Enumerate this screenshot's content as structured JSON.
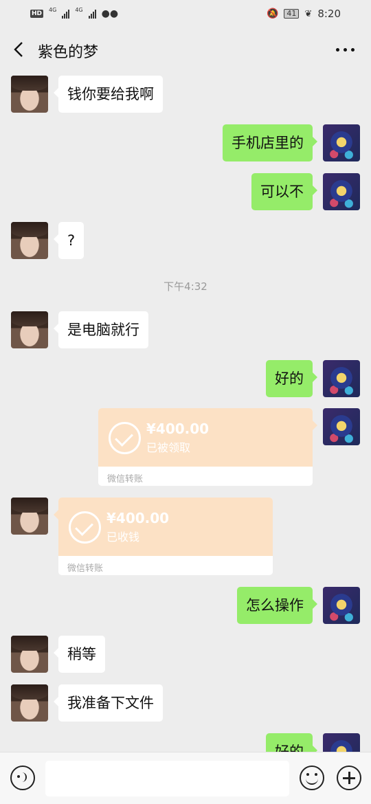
{
  "status_bar": {
    "left_badge": "HD",
    "net_label_1": "4G",
    "net_label_2": "4G",
    "battery": "41",
    "time": "8:20"
  },
  "header": {
    "title": "紫色的梦"
  },
  "messages": [
    {
      "side": "left",
      "text": "钱你要给我啊"
    },
    {
      "side": "right",
      "text": "手机店里的"
    },
    {
      "side": "right",
      "text": "可以不"
    },
    {
      "side": "left",
      "text": "?"
    },
    {
      "type": "timestamp",
      "text": "下午4:32"
    },
    {
      "side": "left",
      "text": "是电脑就行"
    },
    {
      "side": "right",
      "text": "好的"
    },
    {
      "side": "right",
      "type": "transfer",
      "amount": "¥400.00",
      "status": "已被领取",
      "footer": "微信转账"
    },
    {
      "side": "left",
      "type": "transfer",
      "amount": "¥400.00",
      "status": "已收钱",
      "footer": "微信转账"
    },
    {
      "side": "right",
      "text": "怎么操作"
    },
    {
      "side": "left",
      "text": "稍等"
    },
    {
      "side": "left",
      "text": "我准备下文件"
    },
    {
      "side": "right",
      "text": "好的"
    }
  ],
  "input": {
    "placeholder": ""
  },
  "colors": {
    "background": "#ededed",
    "bubble_right": "#95ec69",
    "bubble_left": "#ffffff",
    "transfer": "#fce1c5"
  }
}
